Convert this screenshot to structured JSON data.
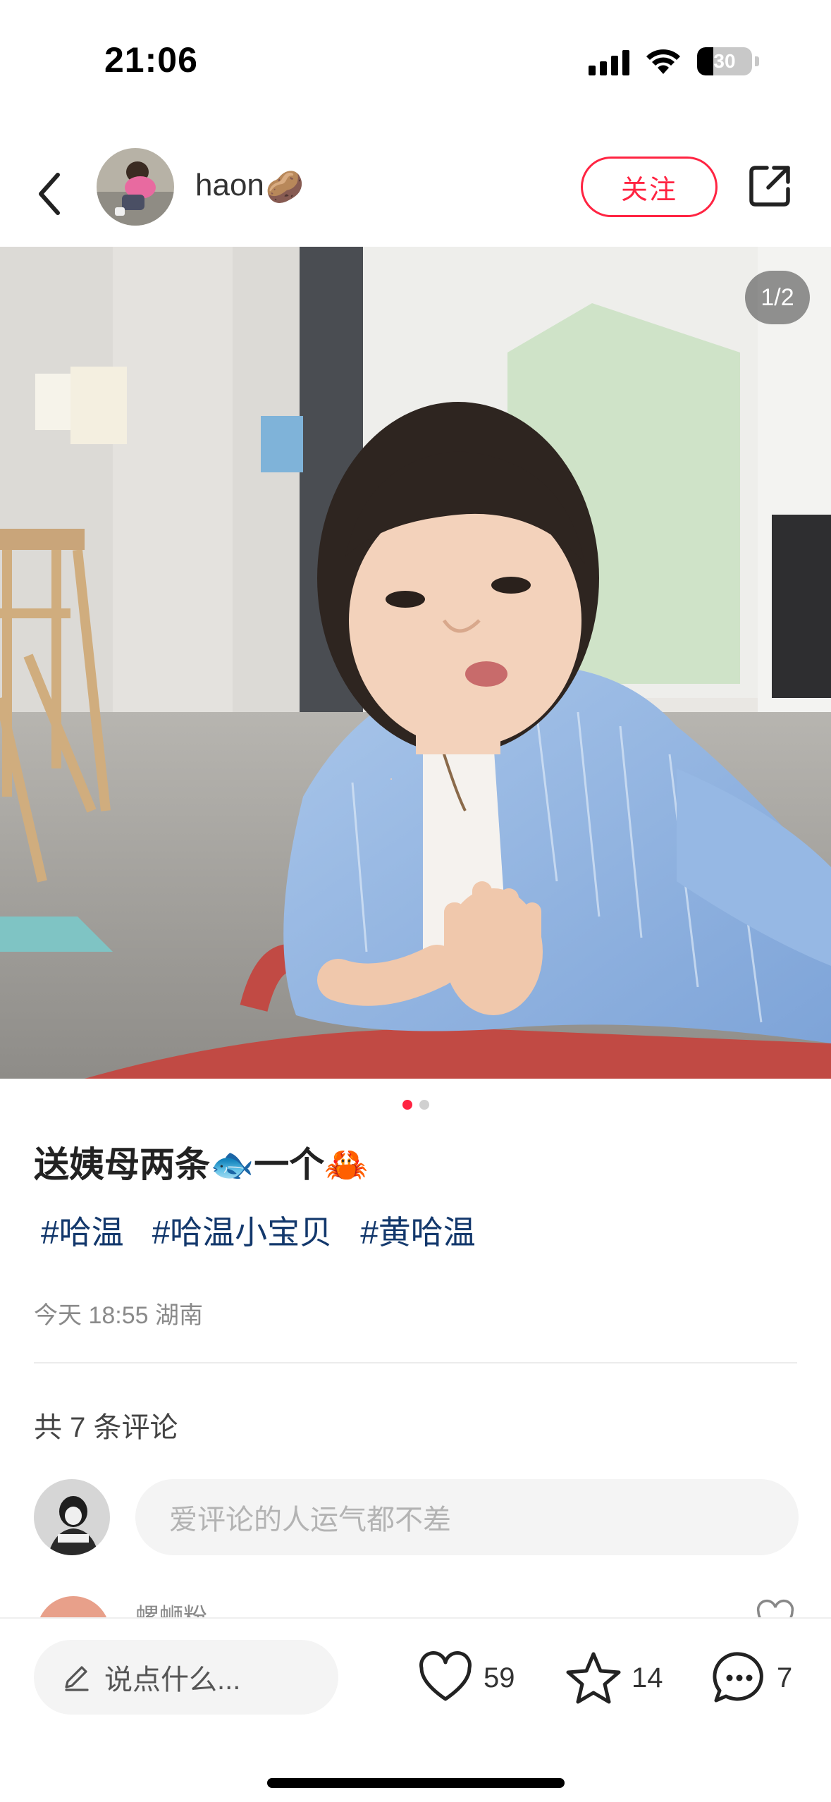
{
  "status_bar": {
    "time": "21:06",
    "battery": "30",
    "battery_fraction": 0.3,
    "icons": [
      "signal-icon",
      "wifi-icon",
      "battery-icon"
    ]
  },
  "header": {
    "back_icon": "chevron-left-icon",
    "username": "haon",
    "username_emoji": "🥔",
    "follow_label": "关注",
    "share_icon": "share-icon"
  },
  "photo": {
    "page_indicator": "1/2",
    "current_page": 1,
    "total_pages": 2
  },
  "post": {
    "title": "送姨母两条🐟一个🦀",
    "hashtags": [
      "#哈温",
      "#哈温小宝贝",
      "#黄哈温"
    ],
    "meta": "今天 18:55 湖南"
  },
  "comments": {
    "count_label": "共 7 条评论",
    "input_placeholder": "爱评论的人运气都不差",
    "peek_name": "螺蛳粉"
  },
  "bottom_bar": {
    "input_label": "说点什么...",
    "likes": "59",
    "collects": "14",
    "comments": "7"
  },
  "colors": {
    "accent": "#ff2442",
    "hashtag": "#13386c",
    "meta": "#8a8a8a"
  }
}
